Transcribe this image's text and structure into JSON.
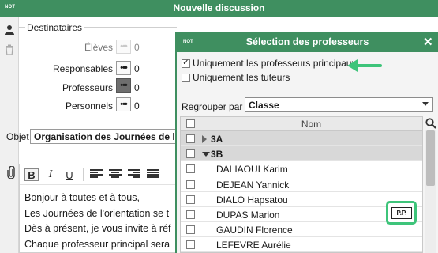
{
  "app": {
    "logo": "NOT",
    "window_title": "Nouvelle discussion"
  },
  "recipients": {
    "section_label": "Destinataires",
    "rows": [
      {
        "label": "Élèves",
        "count": "0"
      },
      {
        "label": "Responsables",
        "count": "0"
      },
      {
        "label": "Professeurs",
        "count": "0"
      },
      {
        "label": "Personnels",
        "count": "0"
      }
    ],
    "dots_label": "•••"
  },
  "message": {
    "object_label": "Objet",
    "object_value": "Organisation des Journées de l'o",
    "toolbar": {
      "bold": "B",
      "italic": "I",
      "underline": "U"
    },
    "body_lines": [
      "Bonjour à toutes et à tous,",
      "Les Journées de l'orientation se t",
      "Dès à présent, je vous invite à réf",
      "Chaque professeur principal sera"
    ]
  },
  "dialog": {
    "logo": "NOT",
    "title": "Sélection des professeurs",
    "close": "✕",
    "option_principal": {
      "label": "Uniquement les professeurs principaux",
      "checked": true
    },
    "option_tutors": {
      "label": "Uniquement les tuteurs",
      "checked": false
    },
    "group_by_label": "Regrouper par :",
    "group_by_value": "Classe",
    "column_name": "Nom",
    "rows": [
      {
        "type": "group",
        "text": "3A",
        "expanded": false
      },
      {
        "type": "group",
        "text": "3B",
        "expanded": true
      },
      {
        "type": "item",
        "text": "DALIAOUI Karim"
      },
      {
        "type": "item",
        "text": "DEJEAN Yannick"
      },
      {
        "type": "item",
        "text": "DIALO Hapsatou"
      },
      {
        "type": "item",
        "text": "DUPAS Marion",
        "badge": "P.P."
      },
      {
        "type": "item",
        "text": "GAUDIN Florence"
      },
      {
        "type": "item",
        "text": "LEFEVRE Aurélie"
      }
    ],
    "highlight_color": "#3ec47a"
  },
  "colors": {
    "accent": "#3f8f60",
    "annotation_green": "#3ec47a"
  },
  "icons": [
    "user-icon",
    "trash-icon",
    "paperclip-icon",
    "search-icon",
    "arrow-icon"
  ]
}
